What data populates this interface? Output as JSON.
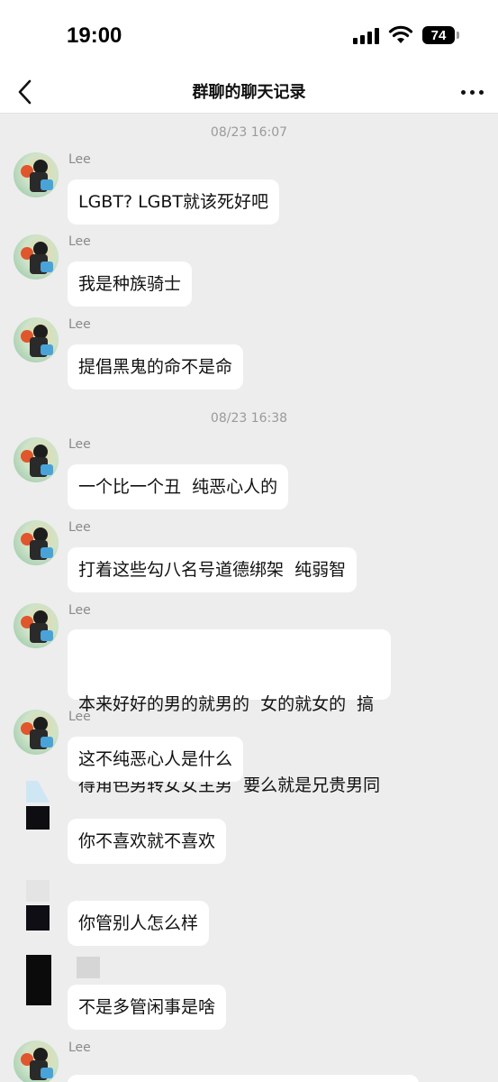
{
  "status_bar": {
    "time": "19:00",
    "battery": "74"
  },
  "nav": {
    "title": "群聊的聊天记录"
  },
  "timestamps": [
    "08/23 16:07",
    "08/23 16:38"
  ],
  "messages": [
    {
      "sender": "Lee",
      "lines": [
        "LGBT? LGBT就该死好吧"
      ]
    },
    {
      "sender": "Lee",
      "lines": [
        "我是种族骑士"
      ]
    },
    {
      "sender": "Lee",
      "lines": [
        "提倡黑鬼的命不是命"
      ]
    },
    {
      "sender": "Lee",
      "lines": [
        "一个比一个丑  纯恶心人的"
      ]
    },
    {
      "sender": "Lee",
      "lines": [
        "打着这些勾八名号道德绑架  纯弱智"
      ]
    },
    {
      "sender": "Lee",
      "lines": [
        "本来好好的男的就男的  女的就女的  搞",
        "得角色男转女女主男  要么就是兄贵男同"
      ]
    },
    {
      "sender": "Lee",
      "lines": [
        "这不纯恶心人是什么"
      ]
    },
    {
      "sender": "",
      "lines": [
        "你不喜欢就不喜欢"
      ]
    },
    {
      "sender": "",
      "lines": [
        "你管别人怎么样"
      ]
    },
    {
      "sender": "",
      "lines": [
        "不是多管闲事是啥"
      ]
    },
    {
      "sender": "Lee",
      "lines": [
        ""
      ]
    }
  ]
}
